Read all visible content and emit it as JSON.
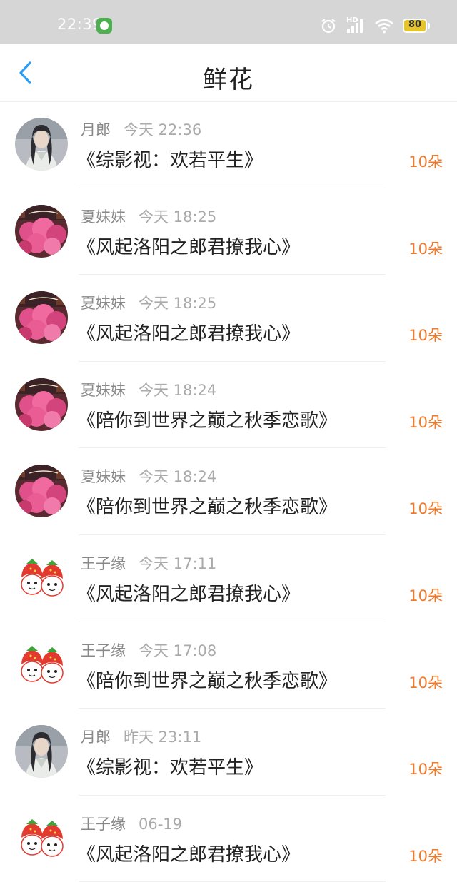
{
  "status_bar": {
    "time": "22:39",
    "battery": "80",
    "hd": "HD"
  },
  "header": {
    "title": "鲜花"
  },
  "items": [
    {
      "user": "月郎",
      "time": "今天 22:36",
      "book": "《综影视：欢若平生》",
      "count": "10朵",
      "avatar": "portrait"
    },
    {
      "user": "夏妹妹",
      "time": "今天 18:25",
      "book": "《风起洛阳之郎君撩我心》",
      "count": "10朵",
      "avatar": "blossom"
    },
    {
      "user": "夏妹妹",
      "time": "今天 18:25",
      "book": "《风起洛阳之郎君撩我心》",
      "count": "10朵",
      "avatar": "blossom"
    },
    {
      "user": "夏妹妹",
      "time": "今天 18:24",
      "book": "《陪你到世界之巅之秋季恋歌》",
      "count": "10朵",
      "avatar": "blossom"
    },
    {
      "user": "夏妹妹",
      "time": "今天 18:24",
      "book": "《陪你到世界之巅之秋季恋歌》",
      "count": "10朵",
      "avatar": "blossom"
    },
    {
      "user": "王子缘",
      "time": "今天 17:11",
      "book": "《风起洛阳之郎君撩我心》",
      "count": "10朵",
      "avatar": "strawberry"
    },
    {
      "user": "王子缘",
      "time": "今天 17:08",
      "book": "《陪你到世界之巅之秋季恋歌》",
      "count": "10朵",
      "avatar": "strawberry"
    },
    {
      "user": "月郎",
      "time": "昨天 23:11",
      "book": "《综影视：欢若平生》",
      "count": "10朵",
      "avatar": "portrait"
    },
    {
      "user": "王子缘",
      "time": "06-19",
      "book": "《风起洛阳之郎君撩我心》",
      "count": "10朵",
      "avatar": "strawberry"
    }
  ],
  "colors": {
    "status_bar_bg": "#d6d6d6",
    "accent_back": "#2a9df4",
    "count": "#f07a2c"
  }
}
